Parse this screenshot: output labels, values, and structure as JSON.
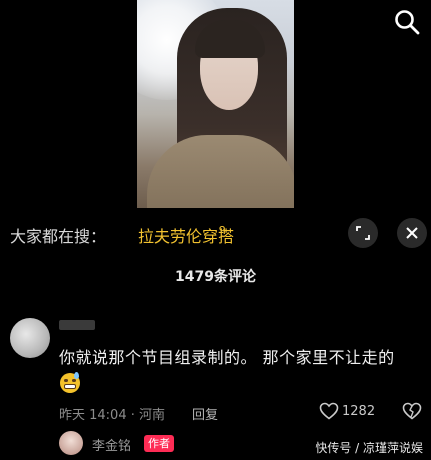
{
  "video": {
    "search_icon": "search-icon"
  },
  "trend": {
    "prefix": "大家都在搜：",
    "term": "拉夫劳伦穿搭",
    "term_icon": "ᑫ",
    "expand_icon": "expand-icon",
    "close_icon": "close-icon"
  },
  "comments": {
    "count_label": "1479条评论",
    "items": [
      {
        "text": "你就说那个节目组录制的。 那个家里不让走的",
        "emoji": "grinning-sweat-emoji",
        "meta": "昨天 14:04 · 河南",
        "reply_label": "回复",
        "like_count": "1282"
      }
    ],
    "author_reply": {
      "name": "李金铭",
      "badge": "作者"
    }
  },
  "watermark": "快传号 / 凉瑾萍说娱",
  "colors": {
    "accent": "#f2c230",
    "badge": "#fe2c55",
    "background": "#000000"
  }
}
